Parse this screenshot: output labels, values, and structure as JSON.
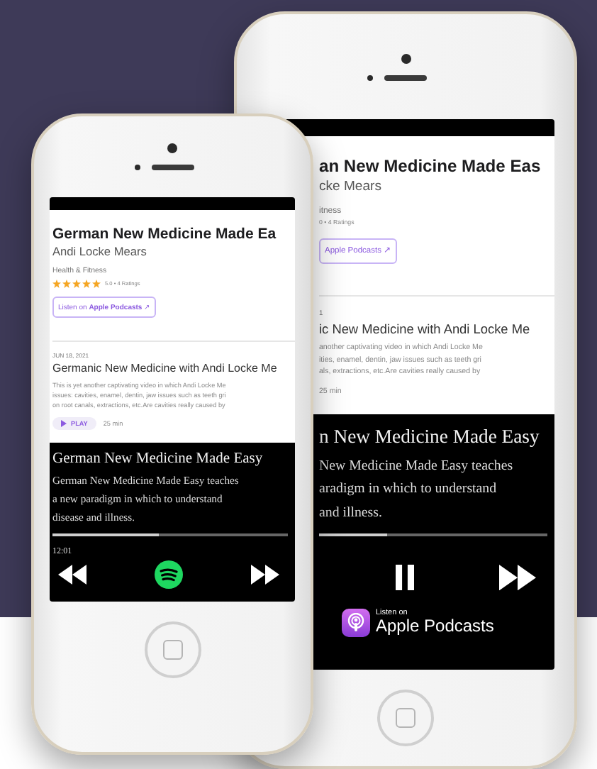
{
  "small_phone": {
    "card": {
      "title": "German New Medicine Made Ea",
      "author": "Andi Locke Mears",
      "category": "Health & Fitness",
      "stars": 5,
      "rating": "5.0 • 4 Ratings",
      "listen_button": "Listen on **Apple Podcasts** ↗",
      "episode": {
        "date": "JUN 18, 2021",
        "title": "Germanic New Medicine with Andi Locke Me",
        "description_lines": [
          "This is yet another captivating video in which Andi Locke Me",
          "issues: cavities, enamel, dentin, jaw issues such as teeth gri",
          "on root canals, extractions, etc.Are cavities really caused by"
        ],
        "play_button": "PLAY",
        "duration": "25 min"
      }
    },
    "player": {
      "title": "German New Medicine Made Easy",
      "description_lines": [
        "German New Medicine Made Easy teaches",
        "a new paradigm in which to understand",
        "disease and illness."
      ],
      "progress": {
        "level": 0.45
      },
      "time": "12:01",
      "controls": [
        {
          "kind": "rewind"
        },
        {
          "kind": "spotify"
        },
        {
          "kind": "forward"
        }
      ]
    }
  },
  "large_phone": {
    "card": {
      "title": "an New Medicine Made Eas",
      "author": "cke Mears",
      "category": "itness",
      "rating": "0 • 4 Ratings",
      "listen_button": "Apple Podcasts ↗",
      "episode": {
        "date": "1",
        "title": "ic New Medicine with Andi Locke Me",
        "description_lines": [
          "another captivating video in which Andi Locke Me",
          "ities, enamel, dentin, jaw issues such as teeth gri",
          "als, extractions, etc.Are cavities really caused by"
        ],
        "duration": "25 min"
      }
    },
    "player": {
      "title": "n New Medicine Made Easy",
      "description_lines": [
        "New Medicine Made Easy teaches",
        "aradigm in which to understand",
        "and illness."
      ],
      "progress": {
        "level": 0.3
      },
      "controls": [
        {
          "kind": "pause"
        },
        {
          "kind": "forward"
        }
      ],
      "badge": {
        "small_text": "Listen on",
        "big_text": "Apple Podcasts"
      }
    }
  }
}
